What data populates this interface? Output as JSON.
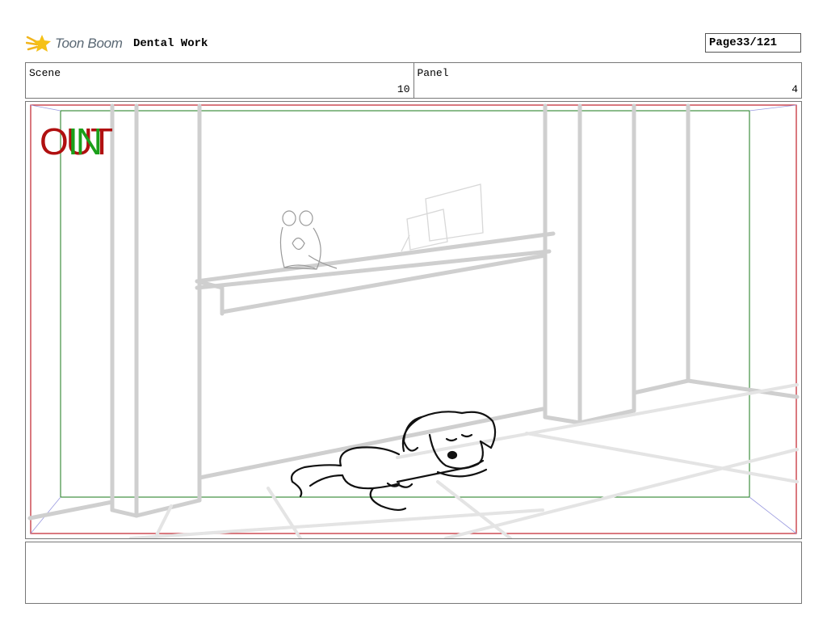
{
  "header": {
    "logo_text": "Toon Boom",
    "title": "Dental Work",
    "page_label": "Page",
    "page_value": "33/121"
  },
  "info": {
    "scene_label": "Scene",
    "scene_value": "10",
    "panel_label": "Panel",
    "panel_value": "4"
  },
  "panel": {
    "out_marker": "OUT",
    "in_marker": "IN",
    "out_color": "#b01010",
    "in_color": "#1aa01a"
  },
  "notes": {
    "text": ""
  }
}
